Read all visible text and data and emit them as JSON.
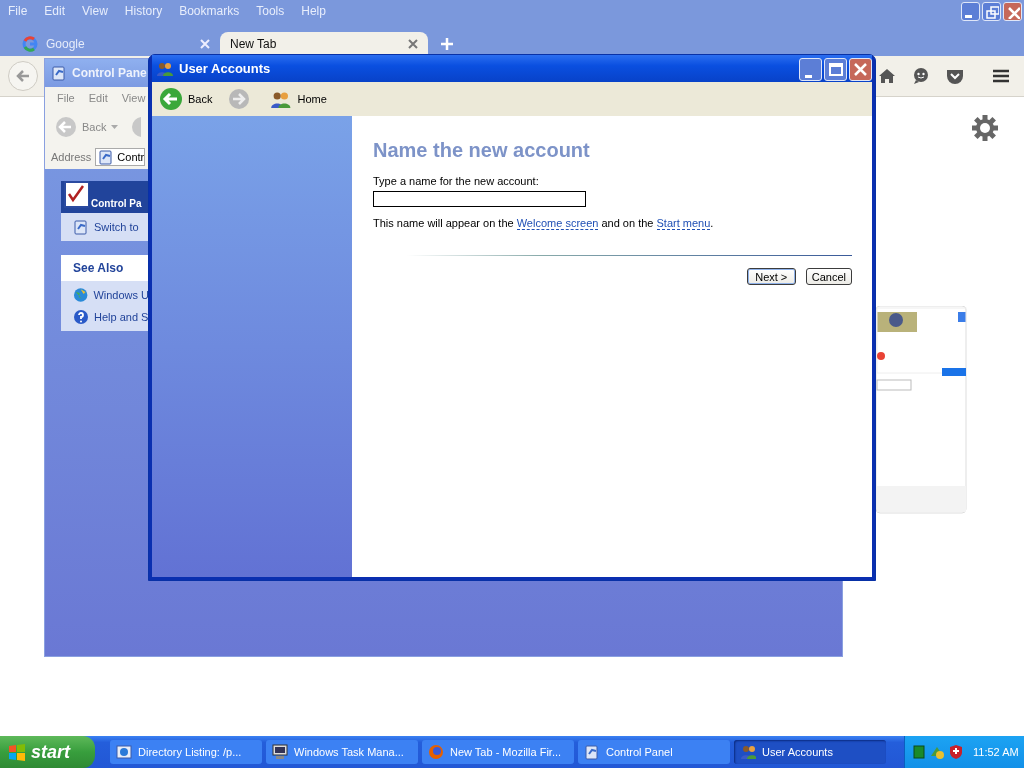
{
  "browser": {
    "menu": [
      "File",
      "Edit",
      "View",
      "History",
      "Bookmarks",
      "Tools",
      "Help"
    ],
    "tabs": [
      {
        "label": "Google",
        "selected": false
      },
      {
        "label": "New Tab",
        "selected": true
      }
    ]
  },
  "control_panel": {
    "title": "Control Pane",
    "menu": [
      "File",
      "Edit",
      "View"
    ],
    "back": "Back",
    "address_label": "Address",
    "address": "Contr",
    "panel_title": "Control Pa",
    "switch": "Switch to",
    "see_also": {
      "title": "See Also",
      "items": [
        "Windows U",
        "Help and S"
      ]
    }
  },
  "user_accounts": {
    "title": "User Accounts",
    "toolbar": {
      "back": "Back",
      "home": "Home"
    },
    "heading": "Name the new account",
    "prompt": "Type a name for the new account:",
    "note": [
      {
        "kind": "text",
        "text": "This name will appear on the "
      },
      {
        "kind": "link",
        "text": "Welcome screen"
      },
      {
        "kind": "text",
        "text": " and on the "
      },
      {
        "kind": "link",
        "text": "Start menu"
      },
      {
        "kind": "text",
        "text": "."
      }
    ],
    "buttons": [
      {
        "label": "Next >",
        "default": true
      },
      {
        "label": "Cancel",
        "default": false
      }
    ]
  },
  "taskbar": {
    "start": "start",
    "tasks": [
      {
        "label": "Directory Listing: /p...",
        "selected": false
      },
      {
        "label": "Windows Task Mana...",
        "selected": false
      },
      {
        "label": "New Tab - Mozilla Fir...",
        "selected": false
      },
      {
        "label": "Control Panel",
        "selected": false
      },
      {
        "label": "User Accounts",
        "selected": true
      }
    ],
    "clock": "11:52 AM"
  }
}
